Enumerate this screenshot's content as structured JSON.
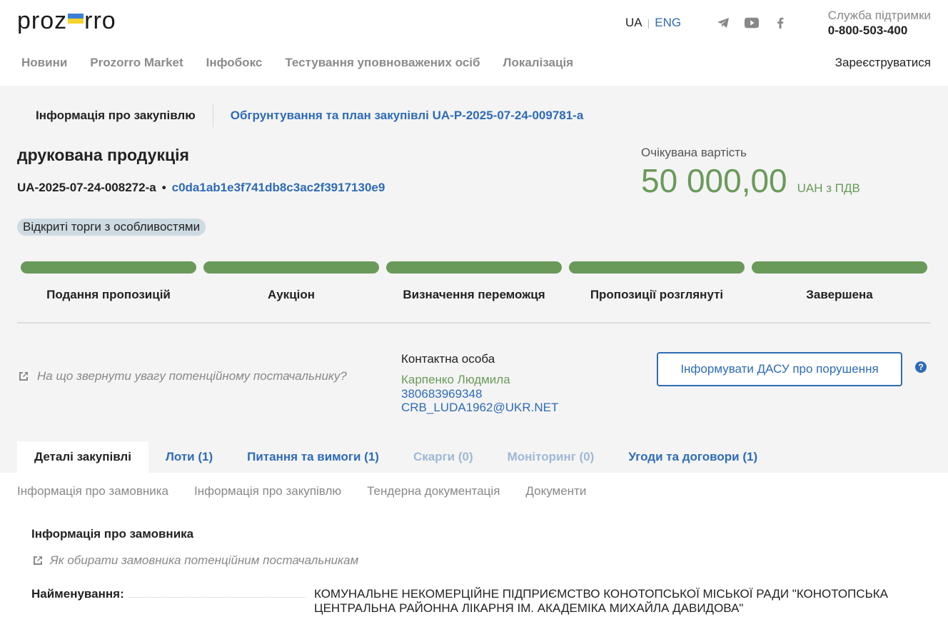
{
  "header": {
    "logo_text_left": "proz",
    "logo_text_right": "rro",
    "lang_ua": "UA",
    "lang_sep": "|",
    "lang_eng": "ENG",
    "support_label": "Служба підтримки",
    "support_phone": "0-800-503-400",
    "register": "Зареєструватися"
  },
  "nav": [
    "Новини",
    "Prozorro Market",
    "Інфобокс",
    "Тестування уповноважених осіб",
    "Локалізація"
  ],
  "info_row": {
    "procurement_info": "Інформація про закупівлю",
    "plan_link": "Обгрунтування та план закупівлі UA-P-2025-07-24-009781-a"
  },
  "tender": {
    "title": "друкована продукція",
    "id": "UA-2025-07-24-008272-a",
    "sep": "•",
    "hash": "c0da1ab1e3f741db8c3ac2f3917130e9",
    "expected_label": "Очікувана вартість",
    "amount": "50 000,00",
    "currency": "UAH з ПДВ",
    "procedure": "Відкриті торги з особливостями"
  },
  "stages": [
    "Подання пропозицій",
    "Аукціон",
    "Визначення переможця",
    "Пропозиції розглянуті",
    "Завершена"
  ],
  "attention_link": "На що звернути увагу потенційному постачальнику?",
  "contact": {
    "heading": "Контактна особа",
    "name": "Карпенко Людмила",
    "phone": "380683969348",
    "email": "CRB_LUDA1962@UKR.NET"
  },
  "dasu_button": "Інформувати ДАСУ про порушення",
  "help": "?",
  "tabs": [
    {
      "label": "Деталі закупівлі"
    },
    {
      "label": "Лоти (1)"
    },
    {
      "label": "Питання та вимоги (1)"
    },
    {
      "label": "Скарги (0)"
    },
    {
      "label": "Моніторинг (0)"
    },
    {
      "label": "Угоди та договори (1)"
    }
  ],
  "subtabs": [
    "Інформація про замовника",
    "Інформація про закупівлю",
    "Тендерна документація",
    "Документи"
  ],
  "customer": {
    "section_title": "Інформація про замовника",
    "how_link": "Як обирати замовника потенційним постачальникам",
    "name_key": "Найменування:",
    "name_value": "КОМУНАЛЬНЕ НЕКОМЕРЦІЙНЕ ПІДПРИЄМСТВО КОНОТОПСЬКОЇ МІСЬКОЇ РАДИ \"КОНОТОПСЬКА ЦЕНТРАЛЬНА РАЙОННА ЛІКАРНЯ ІМ. АКАДЕМІКА МИХАЙЛА ДАВИДОВА\""
  },
  "colors": {
    "accent_blue": "#2e6bb6",
    "stage_green": "#6a9a5a",
    "badge_bg": "#cfdbe3"
  },
  "stage_progress": [
    1,
    1,
    1,
    1,
    1
  ]
}
